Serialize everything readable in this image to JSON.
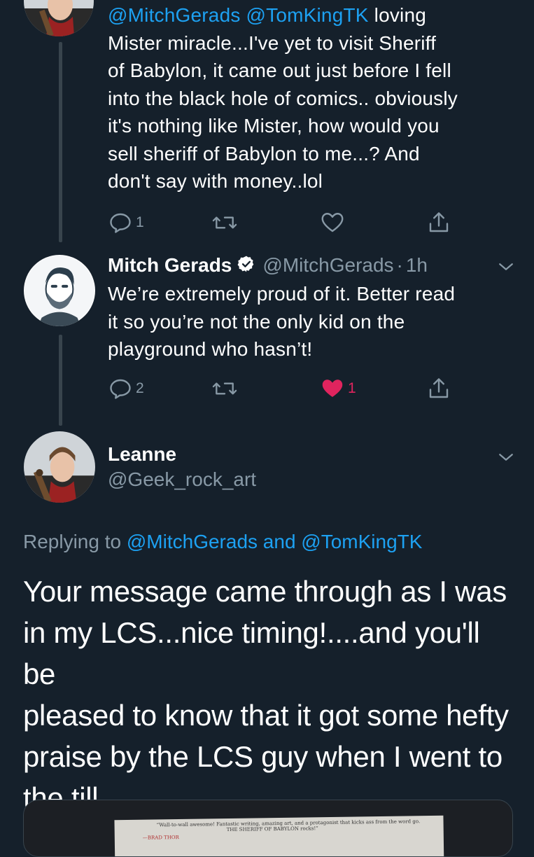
{
  "tweet1": {
    "mentions": "@MitchGerads @TomKingTK",
    "text_lines": [
      "loving",
      "Mister miracle...I've yet to visit Sheriff",
      "of Babylon, it came out just before I fell",
      "into the black hole of comics.. obviously",
      "it's nothing like Mister, how would you",
      "sell sheriff of Babylon to me...? And",
      "don't say with money..lol"
    ],
    "reply_count": "1",
    "retweet_count": "",
    "like_count": ""
  },
  "tweet2": {
    "name": "Mitch Gerads",
    "handle": "@MitchGerads",
    "separator": "·",
    "time": "1h",
    "text_lines": [
      "We’re extremely proud of it. Better read",
      "it so you’re not the only kid on the",
      "playground who hasn’t!"
    ],
    "reply_count": "2",
    "retweet_count": "",
    "like_count": "1"
  },
  "main_tweet": {
    "name": "Leanne",
    "handle": "@Geek_rock_art",
    "replying_prefix": "Replying to",
    "replying_to": "@MitchGerads and @TomKingTK",
    "text_lines": [
      "Your message came through as I was",
      "in my LCS...nice timing!....and you'll be",
      "pleased to know that it got some hefty",
      "praise by the LCS guy when I went to",
      "the till"
    ],
    "media": {
      "quote_line1": "“Wall-to-wall awesome! Fantastic writing, amazing art, and a protagonist that kicks ass from the word go.",
      "quote_line2": "THE SHERIFF OF BABYLON rocks!”",
      "quote_line3": "—BRAD THOR"
    }
  },
  "colors": {
    "background": "#15202b",
    "link": "#1da1f2",
    "secondary_text": "#8899a6",
    "like_active": "#e0245e",
    "thread_line": "#38444d"
  },
  "icons": [
    "reply-icon",
    "retweet-icon",
    "like-icon",
    "share-icon",
    "verified-badge-icon",
    "chevron-down-icon"
  ]
}
